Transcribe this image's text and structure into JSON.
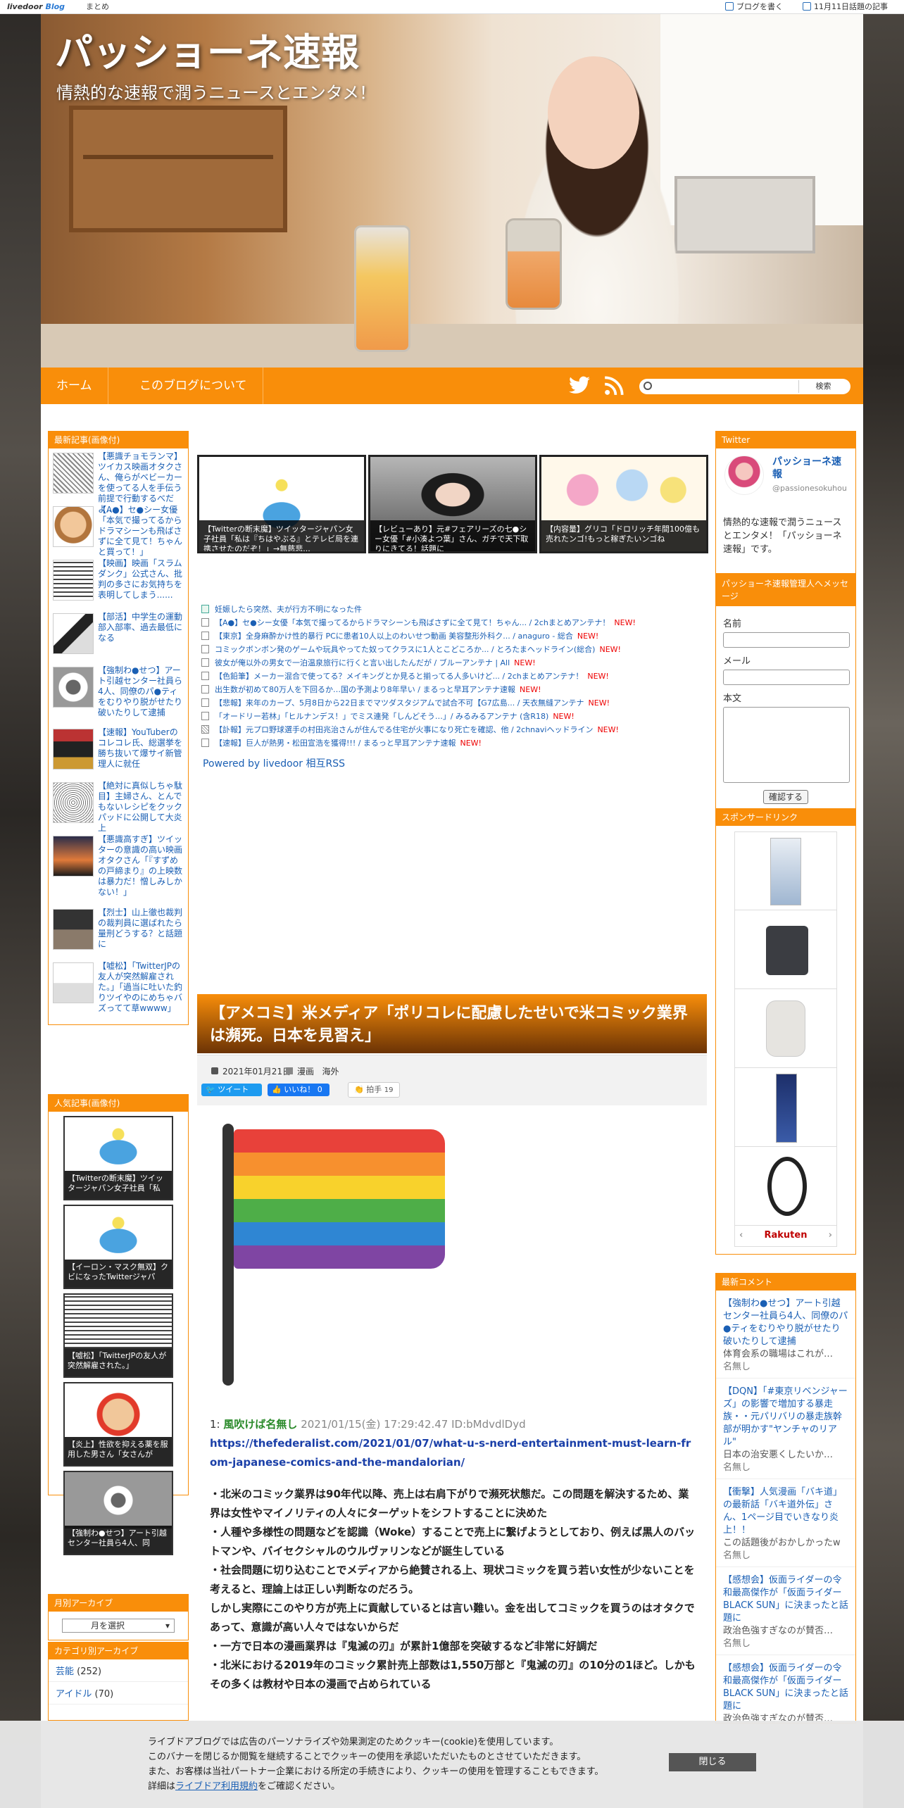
{
  "topbar": {
    "logo_main": "livedoor",
    "logo_sub": "Blog",
    "summary": "まとめ",
    "write_blog": "ブログを書く",
    "topic": "11月11日話題の記事"
  },
  "header": {
    "title": "パッショーネ速報",
    "description": "情熱的な速報で潤うニュースとエンタメ！"
  },
  "nav": {
    "items": [
      "ホーム",
      "このブログについて"
    ],
    "search_button": "検索"
  },
  "left": {
    "recent_title": "最新記事(画像付)",
    "recent": [
      "【悪識チョモランマ】ツイカス映画オタクさん、俺らがベビーカーを使ってる人を手伝う前提で行動するべだよ...",
      "【A●】セ●シー女優「本気で撮ってるからドラマシーンも飛ばさずに全て見て！ちゃんと買って！」",
      "【映画】映画「スラムダンク」公式さん、批判の多さにお気持ちを表明してしまう......",
      "【部活】中学生の運動部入部率、過去最低になる",
      "【強制わ●せつ】アート引越センター社員ら4人、同僚のパ●ティをむりやり脱がせたり破いたりして逮捕",
      "【速報】YouTuberのコレコレ氏、総選挙を勝ち抜いて爆サイ新管理人に就任",
      "【絶対に真似しちゃ駄目】主婦さん、とんでもないレシピをクックパッドに公開して大炎上",
      "【悪識高すぎ】ツイッターの意識の高い映画オタクさん「『すずめの戸締まり』の上映数は暴力だ！憎しみしかない！」",
      "【烈士】山上徹也裁判の裁判員に選ばれたら量刑どうする？と話題に",
      "【嘘松】「TwitterJPの友人が突然解雇された。」「過当に吐いた釣りツイやのにめちゃバズってて草wwww」"
    ],
    "popular_title": "人気記事(画像付)",
    "popular": [
      "【Twitterの断末魔】ツイッタージャパン女子社員「私",
      "【イーロン・マスク無双】クビになったTwitterジャパ",
      "【嘘松】「TwitterJPの友人が突然解雇された。」",
      "【炎上】性欲を抑える薬を服用した男さん「女さんが",
      "【強制わ●せつ】アート引越センター社員ら4人、同"
    ],
    "archive_title": "月別アーカイブ",
    "archive_select": "月を選択",
    "category_title": "カテゴリ別アーカイブ",
    "categories": [
      {
        "name": "芸能",
        "count": "(252)"
      },
      {
        "name": "アイドル",
        "count": "(70)"
      }
    ]
  },
  "main": {
    "featured": [
      "【Twitterの断末魔】ツイッタージャパン女子社員「私は『ちはやぶる』とテレビ局を連携させたのだぞ！」→無慈悲...",
      "【レビューあり】元#フェアリーズの七●シー女優「#小湊よつ葉」さん、ガチで天下取りにきてる！話題に",
      "【内容量】グリコ「ドロリッチ年間100億も売れたンゴ!もっと稼ぎたいンゴね"
    ],
    "antenna": [
      {
        "text": "妊娠したら突然、夫が行方不明になった件",
        "new": ""
      },
      {
        "text": "【A●】セ●シー女優「本気で撮ってるからドラマシーンも飛ばさずに全て見て！ちゃん... / 2chまとめアンテナ！",
        "new": "NEW!"
      },
      {
        "text": "【東京】全身麻酔かけ性的暴行 PCに患者10人以上のわいせつ動画 美容整形外科ク... / anaguro - 総合",
        "new": "NEW!"
      },
      {
        "text": "コミックボンボン発のゲームや玩具やってた奴ってクラスに1人とこどころか... / とろたまヘッドライン(総合)",
        "new": "NEW!"
      },
      {
        "text": "彼女が俺以外の男女で一泊温泉旅行に行くと言い出したんだが / ブルーアンテナ | All",
        "new": "NEW!"
      },
      {
        "text": "【色鉛筆】メーカー混合で使ってる？メイキングとか見ると揃ってる人多いけど... / 2chまとめアンテナ！",
        "new": "NEW!"
      },
      {
        "text": "出生数が初めて80万人を下回るか…国の予測より8年早い / まるっと早耳アンテナ速報",
        "new": "NEW!"
      },
      {
        "text": "【悲報】来年のカープ、5月8日から22日までマツダスタジアムで試合不可【G7広島... / 天衣無縫アンテナ",
        "new": "NEW!"
      },
      {
        "text": "「オードリー若林」「ヒルナンデス！」でミス連発「しんどそう…」/ みるみるアンテナ (含R18)",
        "new": "NEW!"
      },
      {
        "text": "【訃報】元プロ野球選手の村田兆治さんが住んでる住宅が火事になり死亡を確認、他 / 2chnaviヘッドライン",
        "new": "NEW!"
      },
      {
        "text": "【速報】巨人が熱男・松田宣浩を獲得!!! / まるっと早耳アンテナ速報",
        "new": "NEW!"
      }
    ],
    "powered": "Powered by livedoor 相互RSS",
    "article": {
      "title": "【アメコミ】米メディア「ポリコレに配慮したせいで米コミック業界は瀕死。日本を見習え」",
      "date": "2021年01月21日",
      "cat1": "漫画",
      "cat2": "海外",
      "tweet": "ツイート",
      "like": "いいね！ 0",
      "clap": "拍手",
      "clap_count": "19",
      "post_num": "1:",
      "post_name": "風吹けば名無し",
      "post_date": "2021/01/15(金) 17:29:42.47 ID:bMdvdlDyd",
      "post_url": "https://thefederalist.com/2021/01/07/what-u-s-nerd-entertainment-must-learn-from-japanese-comics-and-the-mandalorian/",
      "body": [
        "・北米のコミック業界は90年代以降、売上は右肩下がりで瀕死状態だ。この問題を解決するため、業界は女性やマイノリティの人々にターゲットをシフトすることに決めた",
        "・人種や多様性の問題などを認識（Woke）することで売上に繋げようとしており、例えば黒人のバットマンや、バイセクシャルのウルヴァリンなどが誕生している",
        "・社会問題に切り込むことでメディアから絶賛される上、現状コミックを買う若い女性が少ないことを考えると、理論上は正しい判断なのだろう。",
        "しかし実際にこのやり方が売上に貢献しているとは言い難い。金を出してコミックを買うのはオタクであって、意識が高い人々ではないからだ",
        "・一方で日本の漫画業界は『鬼滅の刃』が累計1億部を突破するなど非常に好調だ",
        "・北米における2019年のコミック累計売上部数は1,550万部と『鬼滅の刃』の10分の1ほど。しかもその多くは教材や日本の漫画で占められている"
      ]
    }
  },
  "right": {
    "twitter_title": "Twitter",
    "tw_name": "パッショーネ速報",
    "tw_handle": "@passionesokuhou",
    "tw_desc": "情熱的な速報で潤うニュースとエンタメ！「パッショーネ速報」です。",
    "contact_title": "パッショーネ速報管理人へメッセージ",
    "contact_name": "名前",
    "contact_mail": "メール",
    "contact_body": "本文",
    "contact_submit": "確認する",
    "sponsor_title": "スポンサードリンク",
    "sponsor_brand": "Rakuten",
    "comments_title": "最新コメント",
    "comments": [
      {
        "title": "【強制わ●せつ】アート引越センター社員ら4人、同僚のパ●ティをむりやり脱がせたり破いたりして逮捕",
        "text": "体育会系の職場はこれが…",
        "who": "名無し"
      },
      {
        "title": "【DQN】「#東京リベンジャーズ」の影響で増加する暴走族・・元パリバリの暴走族幹部が明かす\"ヤンチャのリアル\"",
        "text": "日本の治安悪くしたいか…",
        "who": "名無し"
      },
      {
        "title": "【衝撃】人気漫画「バキ道」の最新話「バキ道外伝」さん、1ページ目でいきなり炎上！！",
        "text": "この話題後がおかしかったw",
        "who": "名無し"
      },
      {
        "title": "【感想会】仮面ライダーの令和最高傑作が「仮面ライダーBLACK SUN」に決まったと話題に",
        "text": "政治色強すぎなのが賛否…",
        "who": "名無し"
      },
      {
        "title": "【感想会】仮面ライダーの令和最高傑作が「仮面ライダーBLACK SUN」に決まったと話題に",
        "text": "政治色強すぎなのが賛否…",
        "who": "名無し"
      }
    ]
  },
  "cookie": {
    "lines": [
      "ライブドアブログでは広告のパーソナライズや効果測定のためクッキー(cookie)を使用しています。",
      "このバナーを閉じるか閲覧を継続することでクッキーの使用を承認いただいたものとさせていただきます。",
      "また、お客様は当社パートナー企業における所定の手続きにより、クッキーの使用を管理することもできます。"
    ],
    "last_prefix": "詳細は",
    "last_link": "ライブドア利用規約",
    "last_suffix": "をご確認ください。",
    "close": "閉じる"
  },
  "colors": {
    "accent": "#f98e0a",
    "link": "#1a5fb4",
    "new": "#e00000"
  }
}
